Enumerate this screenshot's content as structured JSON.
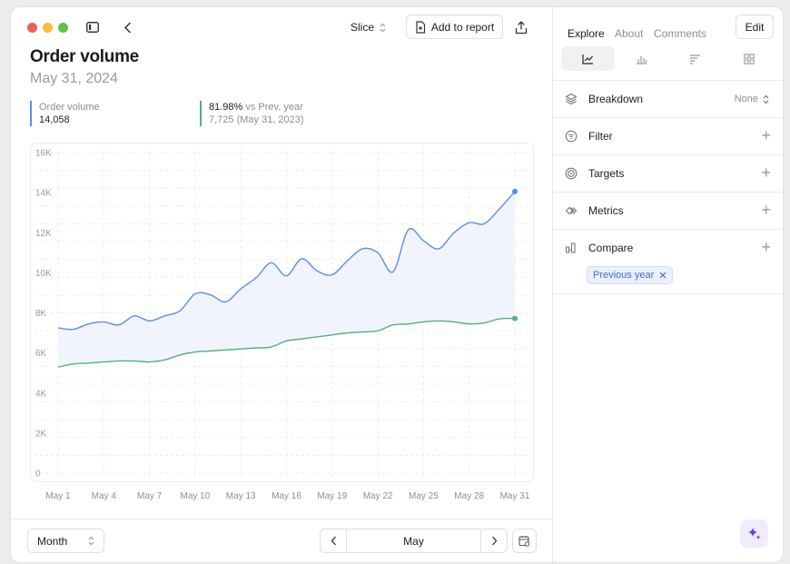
{
  "toolbar": {
    "slice_label": "Slice",
    "add_to_report_label": "Add to report"
  },
  "header": {
    "title": "Order volume",
    "date": "May 31, 2024"
  },
  "kpis": {
    "primary": {
      "label": "Order volume",
      "value": "14,058",
      "color": "#5b8def"
    },
    "comparison": {
      "pct": "81.98%",
      "suffix": " vs Prev. year",
      "detail": "7,725 (May 31, 2023)",
      "color": "#52b07c"
    }
  },
  "chart_data": {
    "type": "line",
    "x": [
      "May 1",
      "May 2",
      "May 3",
      "May 4",
      "May 5",
      "May 6",
      "May 7",
      "May 8",
      "May 9",
      "May 10",
      "May 11",
      "May 12",
      "May 13",
      "May 14",
      "May 15",
      "May 16",
      "May 17",
      "May 18",
      "May 19",
      "May 20",
      "May 21",
      "May 22",
      "May 23",
      "May 24",
      "May 25",
      "May 26",
      "May 27",
      "May 28",
      "May 29",
      "May 30",
      "May 31"
    ],
    "x_ticks": [
      "May 1",
      "May 4",
      "May 7",
      "May 10",
      "May 13",
      "May 16",
      "May 19",
      "May 22",
      "May 25",
      "May 28",
      "May 31"
    ],
    "y_ticks": [
      "0",
      "2K",
      "4K",
      "6K",
      "8K",
      "10K",
      "12K",
      "14K",
      "16K"
    ],
    "ylim": [
      0,
      16000
    ],
    "grid": true,
    "series": [
      {
        "color": "#5b8def",
        "values": [
          7250,
          7180,
          7450,
          7550,
          7400,
          7850,
          7600,
          7850,
          8100,
          8950,
          8900,
          8550,
          9200,
          9750,
          10500,
          9850,
          10700,
          10100,
          9900,
          10600,
          11200,
          11000,
          10050,
          12150,
          11600,
          11200,
          12000,
          12500,
          12450,
          13200,
          14058
        ]
      },
      {
        "color": "#52b07c",
        "values": [
          5300,
          5450,
          5500,
          5550,
          5600,
          5600,
          5550,
          5650,
          5900,
          6050,
          6100,
          6150,
          6200,
          6250,
          6300,
          6600,
          6700,
          6800,
          6900,
          7000,
          7050,
          7100,
          7400,
          7450,
          7550,
          7600,
          7550,
          7450,
          7500,
          7700,
          7725
        ]
      }
    ]
  },
  "footer": {
    "granularity": "Month",
    "period": "May"
  },
  "sidebar": {
    "tabs": [
      "Explore",
      "About",
      "Comments"
    ],
    "edit_label": "Edit",
    "rows": [
      {
        "label": "Breakdown",
        "value": "None"
      },
      {
        "label": "Filter"
      },
      {
        "label": "Targets"
      },
      {
        "label": "Metrics"
      },
      {
        "label": "Compare"
      }
    ],
    "compare_chip": "Previous year"
  },
  "colors": {
    "accent": "#5b8def",
    "comparison": "#52b07c",
    "chip_text": "#3d6fd6",
    "magic": "#6b3fd6"
  }
}
